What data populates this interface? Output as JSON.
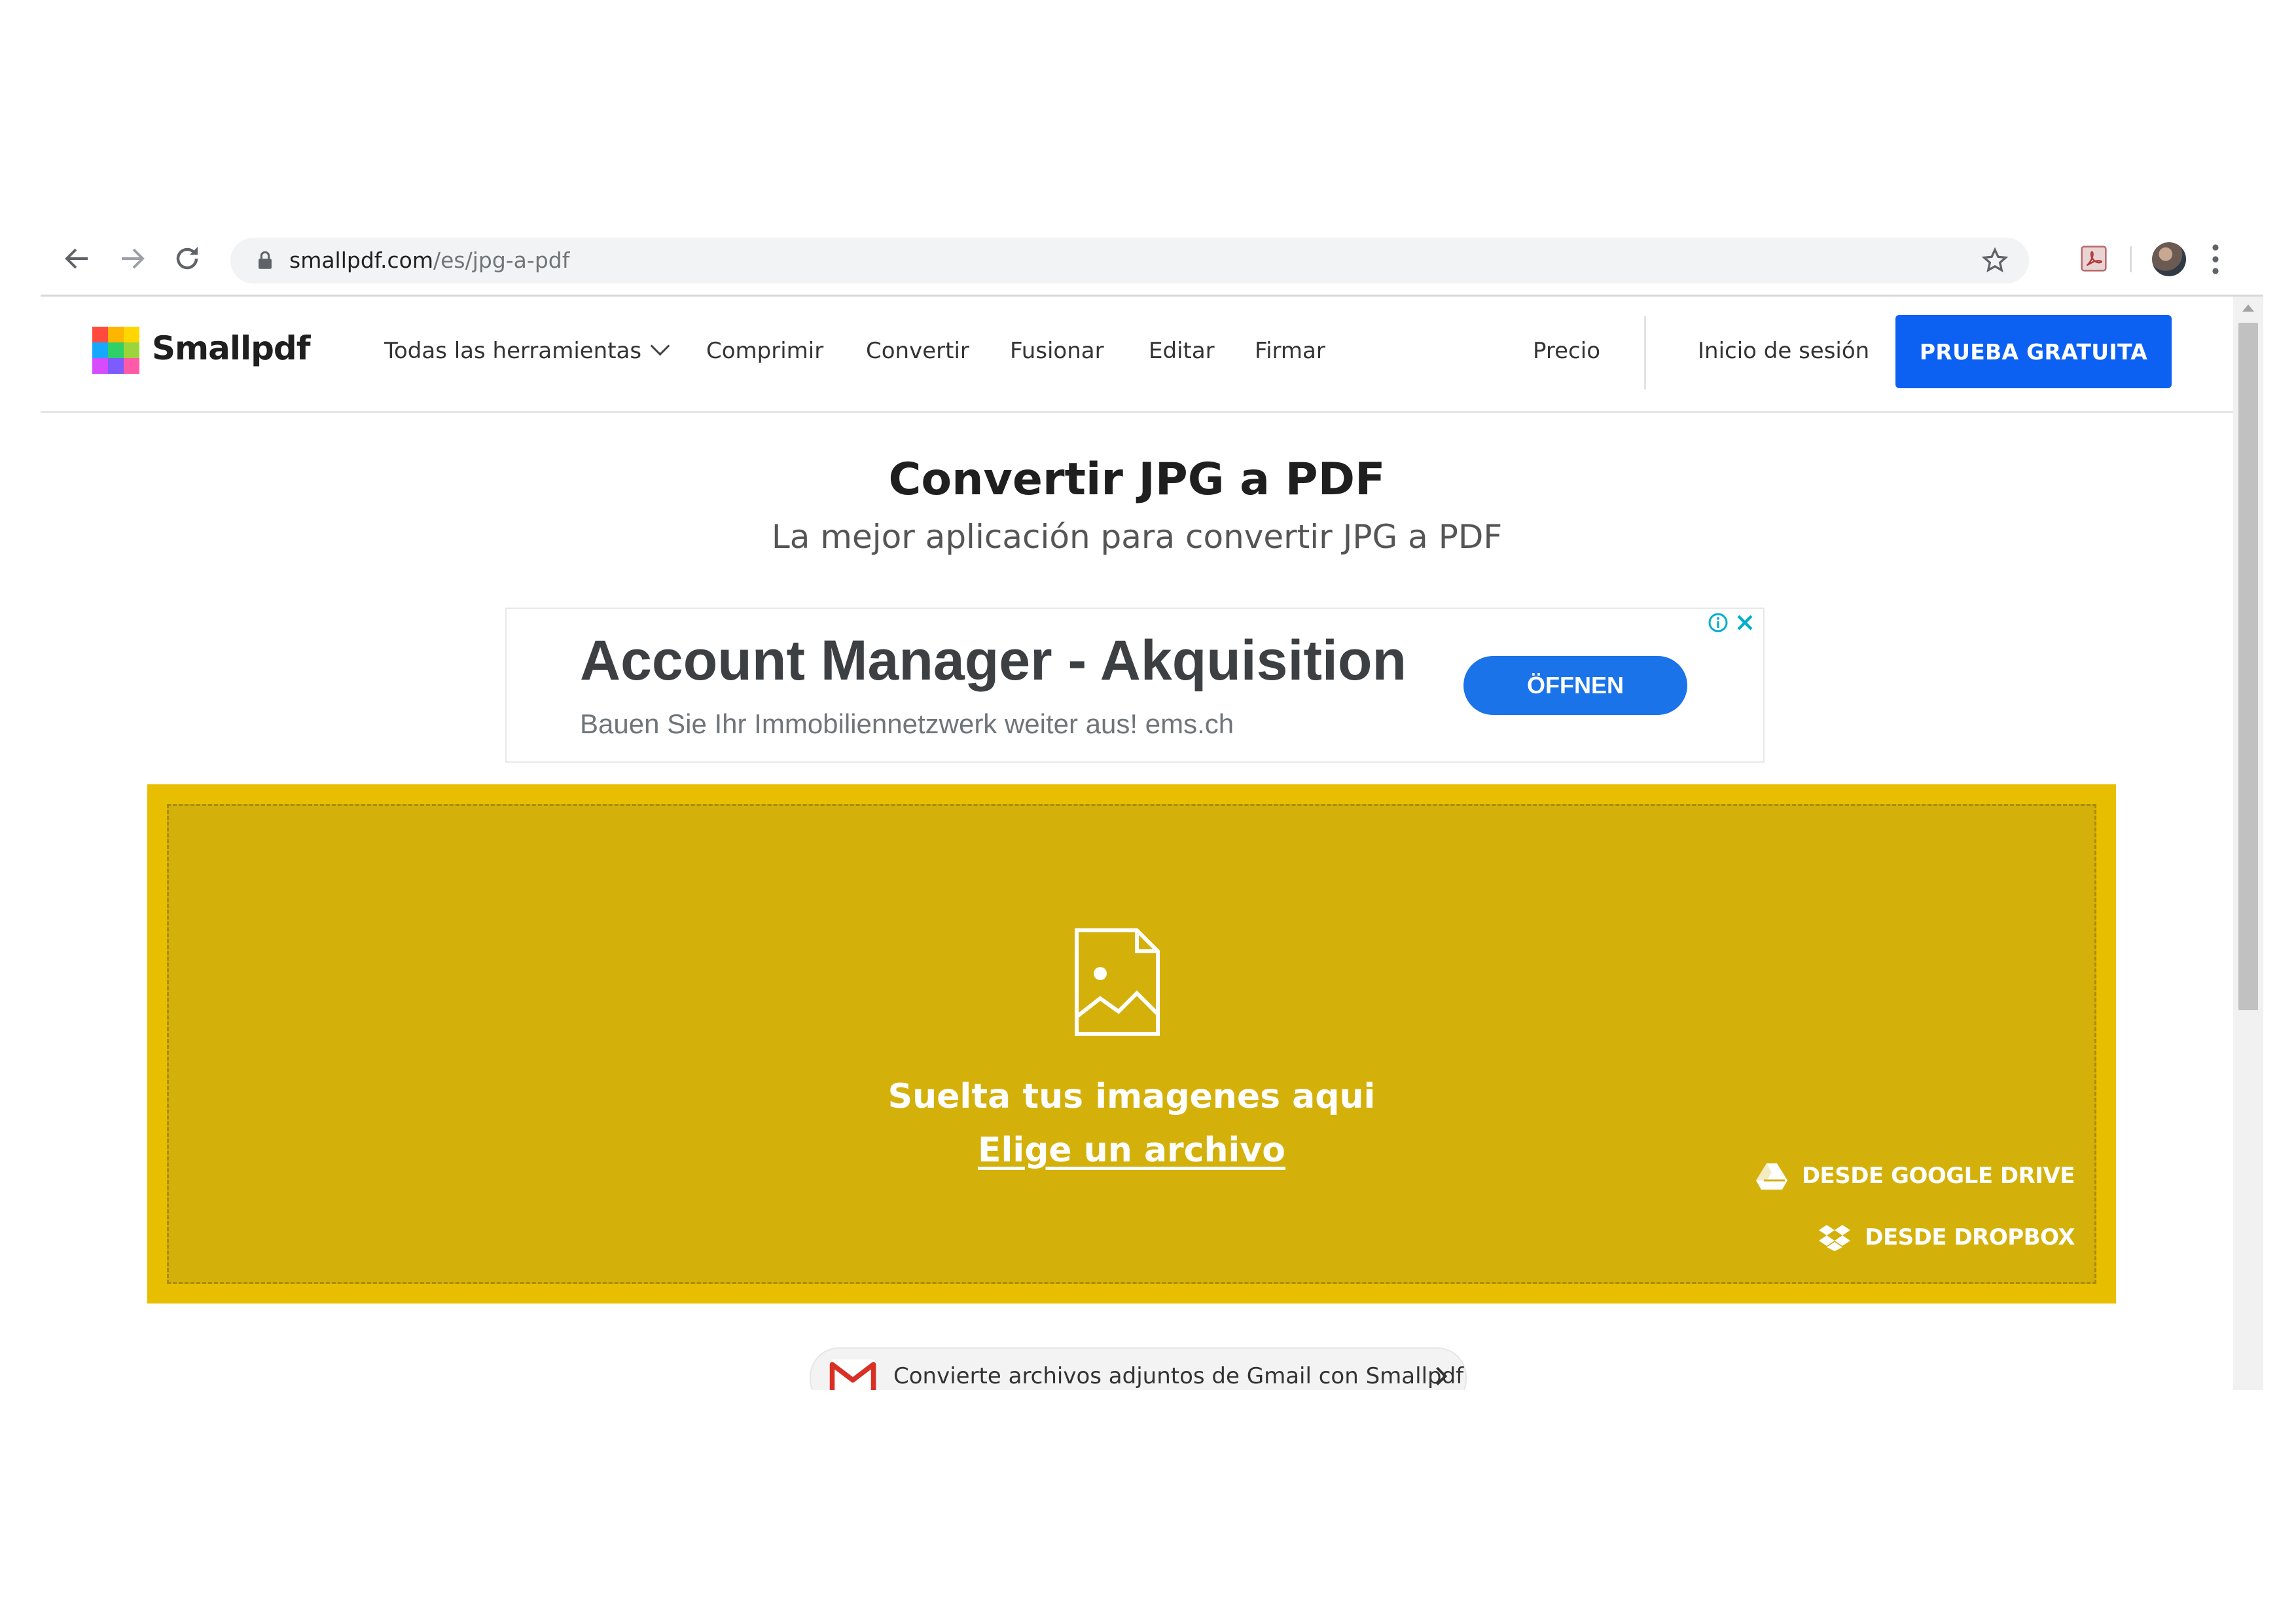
{
  "browser": {
    "url_host": "smallpdf.com",
    "url_path": "/es/jpg-a-pdf",
    "icons": [
      "back-arrow-icon",
      "forward-arrow-icon",
      "reload-icon",
      "lock-icon",
      "star-icon",
      "pdf-extension-icon",
      "profile-avatar",
      "kebab-menu-icon"
    ]
  },
  "header": {
    "brand": "Smallpdf",
    "nav": {
      "all_tools": "Todas las herramientas",
      "compress": "Comprimir",
      "convert": "Convertir",
      "merge": "Fusionar",
      "edit": "Editar",
      "sign": "Firmar"
    },
    "pricing": "Precio",
    "login": "Inicio de sesión",
    "cta": "PRUEBA GRATUITA"
  },
  "main": {
    "title": "Convertir JPG a PDF",
    "subtitle": "La mejor aplicación para convertir JPG a PDF"
  },
  "ad": {
    "title": "Account Manager - Akquisition",
    "description": "Bauen Sie Ihr Immobiliennetzwerk weiter aus! ems.ch",
    "button": "ÖFFNEN"
  },
  "dropzone": {
    "drop_text": "Suelta tus imagenes aqui",
    "choose_link": "Elige un archivo",
    "google_drive": "DESDE GOOGLE DRIVE",
    "dropbox": "DESDE DROPBOX"
  },
  "gmail_banner": {
    "text": "Convierte archivos adjuntos de Gmail con Smallpdf"
  },
  "colors": {
    "cta_blue": "#0d61f2",
    "dropzone_yellow": "#d4b00b",
    "dropzone_border": "#e7be00",
    "ad_button_blue": "#1a73e8"
  }
}
